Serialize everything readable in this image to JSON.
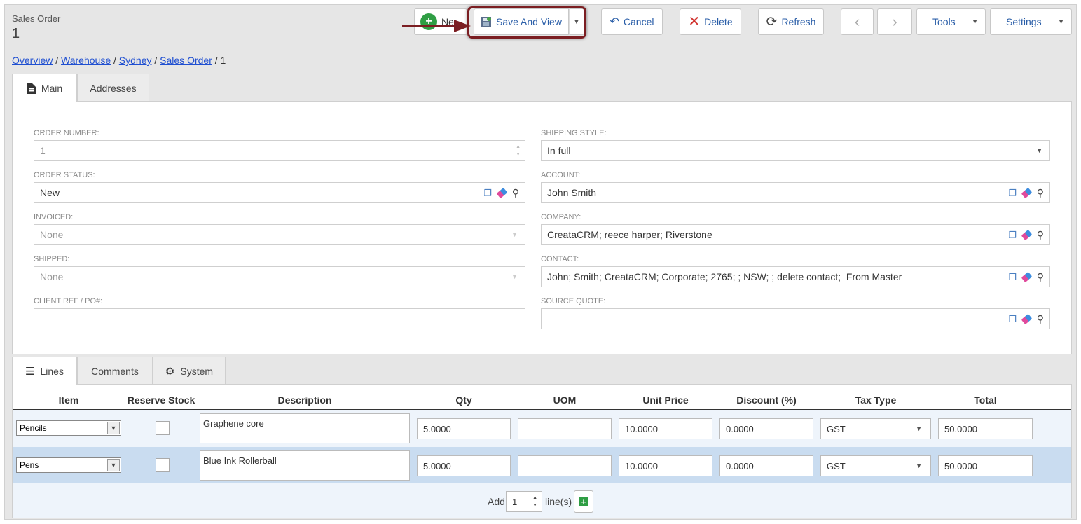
{
  "record": {
    "type_label": "Sales Order",
    "number": "1"
  },
  "toolbar": {
    "new_label": "Ne",
    "save_view_label": "Save And View",
    "cancel_label": "Cancel",
    "delete_label": "Delete",
    "refresh_label": "Refresh",
    "tools_label": "Tools",
    "settings_label": "Settings"
  },
  "breadcrumb": {
    "items": [
      "Overview",
      "Warehouse",
      "Sydney",
      "Sales Order"
    ],
    "current": "1",
    "separator": "/"
  },
  "main_tabs": [
    {
      "label": "Main",
      "icon": "document-icon",
      "active": true
    },
    {
      "label": "Addresses",
      "active": false
    }
  ],
  "fields": {
    "order_number": {
      "label": "ORDER NUMBER:",
      "value": "1"
    },
    "order_status": {
      "label": "ORDER STATUS:",
      "value": "New"
    },
    "invoiced": {
      "label": "INVOICED:",
      "value": "None"
    },
    "shipped": {
      "label": "SHIPPED:",
      "value": "None"
    },
    "client_ref": {
      "label": "CLIENT REF / PO#:",
      "value": ""
    },
    "shipping_style": {
      "label": "SHIPPING STYLE:",
      "value": "In full"
    },
    "account": {
      "label": "ACCOUNT:",
      "value": "John Smith"
    },
    "company": {
      "label": "COMPANY:",
      "value": "CreataCRM; reece harper; Riverstone"
    },
    "contact": {
      "label": "CONTACT:",
      "value": "John; Smith; CreataCRM; Corporate; 2765; ; NSW; ; delete contact;  From Master"
    },
    "source_quote": {
      "label": "SOURCE QUOTE:",
      "value": ""
    }
  },
  "line_tabs": [
    {
      "label": "Lines",
      "icon": "list-icon",
      "active": true
    },
    {
      "label": "Comments",
      "active": false
    },
    {
      "label": "System",
      "icon": "gear-icon",
      "active": false
    }
  ],
  "lines": {
    "columns": [
      "Item",
      "Reserve Stock",
      "Description",
      "Qty",
      "UOM",
      "Unit Price",
      "Discount (%)",
      "Tax Type",
      "Total"
    ],
    "rows": [
      {
        "item": "Pencils",
        "description": "Graphene core",
        "qty": "5.0000",
        "uom": "",
        "unit_price": "10.0000",
        "discount": "0.0000",
        "tax_type": "GST",
        "total": "50.0000"
      },
      {
        "item": "Pens",
        "description": "Blue Ink Rollerball",
        "qty": "5.0000",
        "uom": "",
        "unit_price": "10.0000",
        "discount": "0.0000",
        "tax_type": "GST",
        "total": "50.0000"
      }
    ],
    "add_prefix": "Add",
    "add_count": "1",
    "add_suffix": "line(s)"
  },
  "colors": {
    "accent": "#2a5ea8",
    "highlight": "#7b1e22",
    "row_alt": "#c9dcf0",
    "row": "#eef4fb"
  }
}
